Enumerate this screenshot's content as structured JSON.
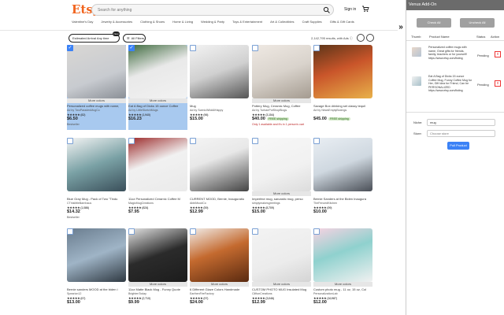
{
  "etsy": {
    "logo": "Etsy",
    "search_placeholder": "Search for anything",
    "signin": "Sign in",
    "categories": [
      "Valentine's Day",
      "Jewelry & Accessories",
      "Clothing & Shoes",
      "Home & Living",
      "Wedding & Party",
      "Toys & Entertainment",
      "Art & Collectibles",
      "Craft Supplies",
      "Gifts & Gift Cards"
    ],
    "filters": {
      "estimated_arrival": "Estimated Arrival Any time",
      "all_filters": "All Filters",
      "new_badge": "New",
      "results": "2,142,795 results, with Ads ⓘ"
    },
    "more_colors": "More colors",
    "listings": [
      {
        "title": "Personalized coffee mugs with name,",
        "shop": "Ad by TwoParadesMugCo",
        "stars": "★★★★★ (82)",
        "price": "$6.50",
        "tag": "Bestseller",
        "selected": true,
        "checked": true,
        "more": true,
        "ship": "",
        "tagline": ""
      },
      {
        "title": "Eat A Bag of Dicks 15 ounce Coffee",
        "shop": "Ad by LittleSketchMugs",
        "stars": "★★★★★ (1,940)",
        "price": "$16.23",
        "tag": "",
        "selected": true,
        "checked": true,
        "more": true,
        "ship": "",
        "tagline": ""
      },
      {
        "title": "Mug",
        "shop": "Ad by ScenicWildAllHappy",
        "stars": "★★★★★ (96)",
        "price": "$15.00",
        "tag": "",
        "selected": false,
        "checked": false,
        "more": false,
        "ship": "",
        "tagline": ""
      },
      {
        "title": "Pottery Mug, Ceramic Mug, Coffee",
        "shop": "Ad by TurbanPotShopBlogs",
        "stars": "★★★★★ (3,154)",
        "price": "$40.00",
        "tag": "Only 1 available and it's in 1 person's cart",
        "selected": false,
        "checked": false,
        "more": true,
        "ship": "FREE shipping",
        "tagline": ""
      },
      {
        "title": "Savage Box drinking set classy tequil",
        "shop": "Ad by NewsEmptyBoxings",
        "stars": "",
        "price": "$45.00",
        "tag": "",
        "selected": false,
        "checked": false,
        "more": false,
        "ship": "FREE shipping",
        "tagline": ""
      },
      {
        "title": "Blue Gray Mug - Pack of Two \"Tindu",
        "shop": "CThislittleBarnhaus",
        "stars": "★★★★★ (1,086)",
        "price": "$14.32",
        "tag": "Bestseller",
        "selected": false,
        "checked": false,
        "more": false,
        "ship": "",
        "tagline": ""
      },
      {
        "title": "11oz Personalized Ceramic Coffee M",
        "shop": "MagicMugCreations",
        "stars": "★★★★★ (824)",
        "price": "$7.95",
        "tag": "",
        "selected": false,
        "checked": false,
        "more": false,
        "ship": "",
        "tagline": ""
      },
      {
        "title": "CURRENT MOOD, Bernie, Inauguratio",
        "shop": "AbbiMoodCo",
        "stars": "★★★★★ (59)",
        "price": "$12.99",
        "tag": "",
        "selected": false,
        "checked": false,
        "more": false,
        "ship": "",
        "tagline": ""
      },
      {
        "title": "Imperfect mug, sarcastic mug, perso",
        "shop": "simplymakesgreetings",
        "stars": "★★★★★ (8,709)",
        "price": "$15.00",
        "tag": "",
        "selected": false,
        "checked": false,
        "more": true,
        "ship": "",
        "tagline": ""
      },
      {
        "title": "Bernie Sanders at the Biden Inaugura",
        "shop": "TheFencedKitchen",
        "stars": "★★★★★ (99)",
        "price": "$10.00",
        "tag": "",
        "selected": false,
        "checked": false,
        "more": false,
        "ship": "",
        "tagline": ""
      },
      {
        "title": "Bernie sanders MOOD at the biden i",
        "shop": "Spearion12",
        "stars": "★★★★★ (67)",
        "price": "$13.00",
        "tag": "",
        "selected": false,
        "checked": false,
        "more": false,
        "ship": "",
        "tagline": ""
      },
      {
        "title": "11oz Matte Black Mug - Funny Quote",
        "shop": "BrightenToday",
        "stars": "★★★★★ (2,710)",
        "price": "$9.99",
        "tag": "",
        "selected": false,
        "checked": false,
        "more": true,
        "ship": "",
        "tagline": ""
      },
      {
        "title": "6 Different Glaze Colors Handmade",
        "shop": "EarthenFireFactory",
        "stars": "★★★★★ (97)",
        "price": "$24.00",
        "tag": "",
        "selected": false,
        "checked": false,
        "more": true,
        "ship": "",
        "tagline": ""
      },
      {
        "title": "CUSTOM PHOTO MUG Insulated Mug",
        "shop": "CliftonCreations",
        "stars": "★★★★★ (3,046)",
        "price": "$12.99",
        "tag": "",
        "selected": false,
        "checked": false,
        "more": true,
        "ship": "",
        "tagline": ""
      },
      {
        "title": "Custom photo mug - 11 oz, 15 oz, Col",
        "shop": "PersonalizationLab",
        "stars": "★★★★★ (16,987)",
        "price": "$12.00",
        "tag": "",
        "selected": false,
        "checked": false,
        "more": true,
        "ship": "",
        "tagline": ""
      }
    ]
  },
  "panel": {
    "title": "Venus Add-On",
    "check_all": "Check All",
    "uncheck_all": "Uncheck All",
    "headers": [
      "Thumb",
      "Product Name",
      "Status",
      "Action"
    ],
    "rows": [
      {
        "name": "Personalized coffee mugs with name, Great gifts for friends, family, teachers or for yourself! https://www.etsy.com/listing",
        "status": "Pending",
        "action": "x"
      },
      {
        "name": "Eat A Bag of Dicks 15 ounce Coffee Mug, Funny Coffee Mug for Her, Gift Idea for Friend, Can be PERSONALIZED https://www.etsy.com/listing",
        "status": "Pending",
        "action": "x"
      }
    ],
    "niche_label": "Niche:",
    "niche_value": "mug",
    "store_label": "Store:",
    "store_placeholder": "Choose store",
    "pull_button": "Pull Product"
  },
  "colors": {
    "brand": "#f1641e",
    "accent": "#3b82f6",
    "selected": "#a8c9ef"
  }
}
